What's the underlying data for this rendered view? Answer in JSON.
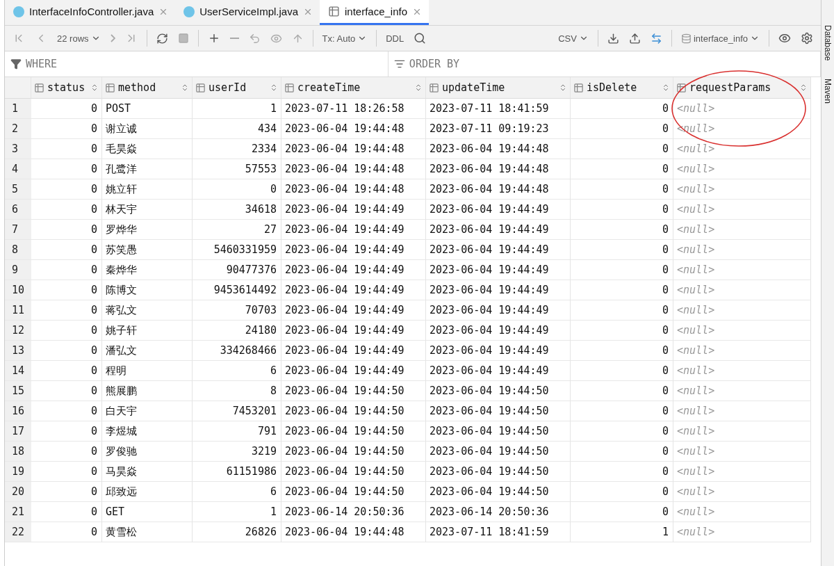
{
  "tabs": [
    {
      "label": "InterfaceInfoController.java",
      "kind": "class",
      "selected": false
    },
    {
      "label": "UserServiceImpl.java",
      "kind": "class",
      "selected": false
    },
    {
      "label": "interface_info",
      "kind": "table",
      "selected": true
    }
  ],
  "toolbar": {
    "rows": "22 rows",
    "transaction": "Tx: Auto",
    "ddl": "DDL",
    "format": "CSV",
    "data_source": "interface_info"
  },
  "filter": {
    "where": "WHERE",
    "order_by": "ORDER BY"
  },
  "side_panel": [
    "Database",
    "Maven"
  ],
  "table": {
    "columns": [
      {
        "name": "status",
        "kind": "number"
      },
      {
        "name": "method",
        "kind": "text"
      },
      {
        "name": "userId",
        "kind": "number"
      },
      {
        "name": "createTime",
        "kind": "text"
      },
      {
        "name": "updateTime",
        "kind": "text"
      },
      {
        "name": "isDelete",
        "kind": "number"
      },
      {
        "name": "requestParams",
        "kind": "null"
      }
    ],
    "rows": [
      {
        "number": "1",
        "cells": [
          "0",
          "POST",
          "1",
          "2023-07-11 18:26:58",
          "2023-07-11 18:41:59",
          "0",
          "<null>"
        ]
      },
      {
        "number": "2",
        "cells": [
          "0",
          "谢立诚",
          "434",
          "2023-06-04 19:44:48",
          "2023-07-11 09:19:23",
          "0",
          "<null>"
        ]
      },
      {
        "number": "3",
        "cells": [
          "0",
          "毛昊焱",
          "2334",
          "2023-06-04 19:44:48",
          "2023-06-04 19:44:48",
          "0",
          "<null>"
        ]
      },
      {
        "number": "4",
        "cells": [
          "0",
          "孔鹭洋",
          "57553",
          "2023-06-04 19:44:48",
          "2023-06-04 19:44:48",
          "0",
          "<null>"
        ]
      },
      {
        "number": "5",
        "cells": [
          "0",
          "姚立轩",
          "0",
          "2023-06-04 19:44:48",
          "2023-06-04 19:44:48",
          "0",
          "<null>"
        ]
      },
      {
        "number": "6",
        "cells": [
          "0",
          "林天宇",
          "34618",
          "2023-06-04 19:44:49",
          "2023-06-04 19:44:49",
          "0",
          "<null>"
        ]
      },
      {
        "number": "7",
        "cells": [
          "0",
          "罗烨华",
          "27",
          "2023-06-04 19:44:49",
          "2023-06-04 19:44:49",
          "0",
          "<null>"
        ]
      },
      {
        "number": "8",
        "cells": [
          "0",
          "苏笑愚",
          "5460331959",
          "2023-06-04 19:44:49",
          "2023-06-04 19:44:49",
          "0",
          "<null>"
        ]
      },
      {
        "number": "9",
        "cells": [
          "0",
          "秦烨华",
          "90477376",
          "2023-06-04 19:44:49",
          "2023-06-04 19:44:49",
          "0",
          "<null>"
        ]
      },
      {
        "number": "10",
        "cells": [
          "0",
          "陈博文",
          "9453614492",
          "2023-06-04 19:44:49",
          "2023-06-04 19:44:49",
          "0",
          "<null>"
        ]
      },
      {
        "number": "11",
        "cells": [
          "0",
          "蒋弘文",
          "70703",
          "2023-06-04 19:44:49",
          "2023-06-04 19:44:49",
          "0",
          "<null>"
        ]
      },
      {
        "number": "12",
        "cells": [
          "0",
          "姚子轩",
          "24180",
          "2023-06-04 19:44:49",
          "2023-06-04 19:44:49",
          "0",
          "<null>"
        ]
      },
      {
        "number": "13",
        "cells": [
          "0",
          "潘弘文",
          "334268466",
          "2023-06-04 19:44:49",
          "2023-06-04 19:44:49",
          "0",
          "<null>"
        ]
      },
      {
        "number": "14",
        "cells": [
          "0",
          "程明",
          "6",
          "2023-06-04 19:44:49",
          "2023-06-04 19:44:49",
          "0",
          "<null>"
        ]
      },
      {
        "number": "15",
        "cells": [
          "0",
          "熊展鹏",
          "8",
          "2023-06-04 19:44:50",
          "2023-06-04 19:44:50",
          "0",
          "<null>"
        ]
      },
      {
        "number": "16",
        "cells": [
          "0",
          "白天宇",
          "7453201",
          "2023-06-04 19:44:50",
          "2023-06-04 19:44:50",
          "0",
          "<null>"
        ]
      },
      {
        "number": "17",
        "cells": [
          "0",
          "李煜城",
          "791",
          "2023-06-04 19:44:50",
          "2023-06-04 19:44:50",
          "0",
          "<null>"
        ]
      },
      {
        "number": "18",
        "cells": [
          "0",
          "罗俊驰",
          "3219",
          "2023-06-04 19:44:50",
          "2023-06-04 19:44:50",
          "0",
          "<null>"
        ]
      },
      {
        "number": "19",
        "cells": [
          "0",
          "马昊焱",
          "61151986",
          "2023-06-04 19:44:50",
          "2023-06-04 19:44:50",
          "0",
          "<null>"
        ]
      },
      {
        "number": "20",
        "cells": [
          "0",
          "邱致远",
          "6",
          "2023-06-04 19:44:50",
          "2023-06-04 19:44:50",
          "0",
          "<null>"
        ]
      },
      {
        "number": "21",
        "cells": [
          "0",
          "GET",
          "1",
          "2023-06-14 20:50:36",
          "2023-06-14 20:50:36",
          "0",
          "<null>"
        ]
      },
      {
        "number": "22",
        "cells": [
          "0",
          "黄雪松",
          "26826",
          "2023-06-04 19:44:48",
          "2023-07-11 18:41:59",
          "1",
          "<null>"
        ]
      }
    ]
  }
}
